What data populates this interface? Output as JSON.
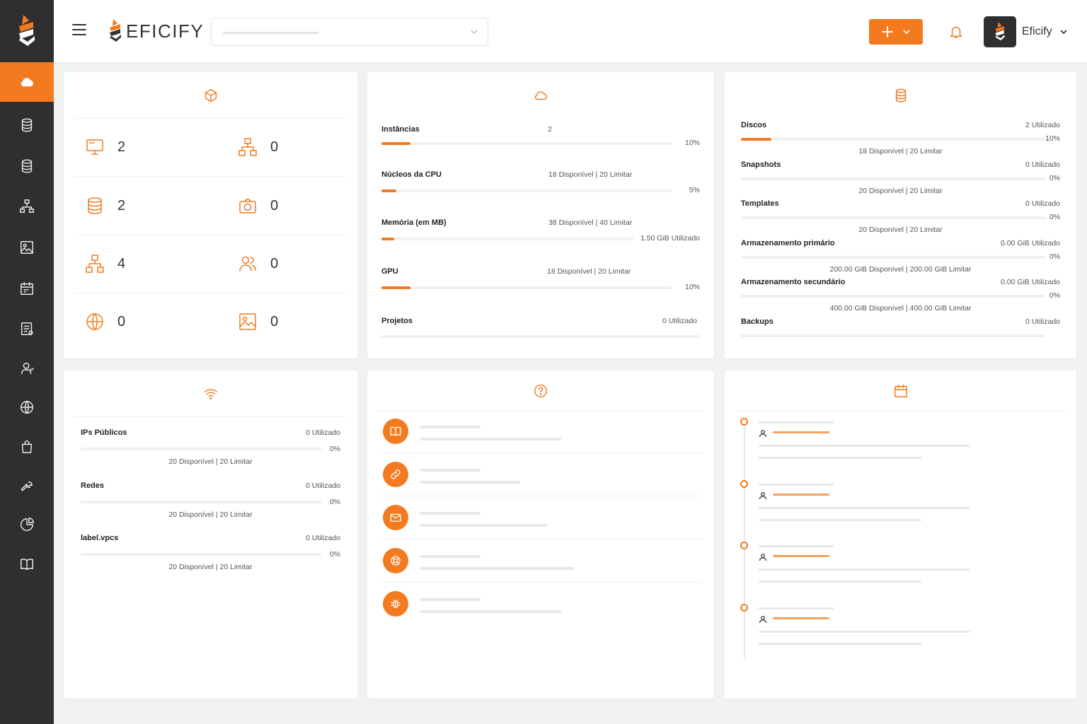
{
  "brand": {
    "name": "EFICIFY",
    "accent": "#f47a1f",
    "sidebar_bg": "#2f2f31"
  },
  "sidebar": {
    "items": [
      {
        "icon": "cloud-icon",
        "active": true
      },
      {
        "icon": "database-icon"
      },
      {
        "icon": "database-icon"
      },
      {
        "icon": "network-icon"
      },
      {
        "icon": "image-icon"
      },
      {
        "icon": "calendar-icon"
      },
      {
        "icon": "report-icon"
      },
      {
        "icon": "user-icon"
      },
      {
        "icon": "globe-icon"
      },
      {
        "icon": "shopping-bag-icon"
      },
      {
        "icon": "wrench-icon"
      },
      {
        "icon": "pie-chart-icon"
      },
      {
        "icon": "book-icon"
      }
    ]
  },
  "header": {
    "user_name": "Eficify",
    "create_icon": "plus-icon",
    "bell_icon": "bell-icon"
  },
  "overview": {
    "header_icon": "cube-icon",
    "counts": [
      {
        "icon": "monitor-icon",
        "value": "2"
      },
      {
        "icon": "network-icon",
        "value": "0"
      },
      {
        "icon": "database-icon",
        "value": "2"
      },
      {
        "icon": "camera-icon",
        "value": "0"
      },
      {
        "icon": "network-icon",
        "value": "4"
      },
      {
        "icon": "users-icon",
        "value": "0"
      },
      {
        "icon": "globe-icon",
        "value": "0"
      },
      {
        "icon": "image-icon",
        "value": "0"
      }
    ]
  },
  "compute": {
    "header_icon": "cloud-icon",
    "rows": [
      {
        "label": "Instâncias",
        "top": "2",
        "percent_text": "10%",
        "percent": 10
      },
      {
        "label": "Núcleos da CPU",
        "top": "18 Disponível | 20 Limitar",
        "percent_text": "5%",
        "percent": 5
      },
      {
        "label": "Memória (em MB)",
        "top": "38 Disponível | 40 Limitar",
        "percent_text": "1.50 GiB Utilizado",
        "percent": 5
      },
      {
        "label": "GPU",
        "top": "18 Disponível | 20 Limitar",
        "percent_text": "10%",
        "percent": 10
      },
      {
        "label": "Projetos",
        "top": "0 Utilizado",
        "percent_text": "",
        "percent": 0
      }
    ]
  },
  "storage": {
    "header_icon": "database-icon",
    "rows": [
      {
        "label": "Discos",
        "used": "2 Utilizado",
        "percent_text": "10%",
        "avail": "18 Disponível | 20 Limitar",
        "percent": 10
      },
      {
        "label": "Snapshots",
        "used": "0 Utilizado",
        "percent_text": "0%",
        "avail": "20 Disponível | 20 Limitar",
        "percent": 0
      },
      {
        "label": "Templates",
        "used": "0 Utilizado",
        "percent_text": "0%",
        "avail": "20 Disponível | 20 Limitar",
        "percent": 0
      },
      {
        "label": "Armazenamento primário",
        "used": "0.00 GiB Utilizado",
        "percent_text": "0%",
        "avail": "200.00 GiB Disponível | 200.00 GiB Limitar",
        "percent": 0
      },
      {
        "label": "Armazenamento secundário",
        "used": "0.00 GiB Utilizado",
        "percent_text": "0%",
        "avail": "400.00 GiB Disponível | 400.00 GiB Limitar",
        "percent": 0
      },
      {
        "label": "Backups",
        "used": "0 Utilizado",
        "percent_text": "",
        "avail": "",
        "percent": 0
      }
    ]
  },
  "network": {
    "header_icon": "wifi-icon",
    "rows": [
      {
        "label": "IPs Públicos",
        "used": "0 Utilizado",
        "percent_text": "0%",
        "avail": "20 Disponível | 20 Limitar",
        "percent": 0
      },
      {
        "label": "Redes",
        "used": "0 Utilizado",
        "percent_text": "0%",
        "avail": "20 Disponível | 20 Limitar",
        "percent": 0
      },
      {
        "label": "label.vpcs",
        "used": "0 Utilizado",
        "percent_text": "0%",
        "avail": "20 Disponível | 20 Limitar",
        "percent": 0
      }
    ]
  },
  "help": {
    "header_icon": "question-icon",
    "items": [
      {
        "icon": "book-icon"
      },
      {
        "icon": "link-icon"
      },
      {
        "icon": "mail-icon"
      },
      {
        "icon": "lifebuoy-icon"
      },
      {
        "icon": "bug-icon"
      }
    ]
  },
  "events": {
    "header_icon": "calendar-icon",
    "count": 4
  }
}
